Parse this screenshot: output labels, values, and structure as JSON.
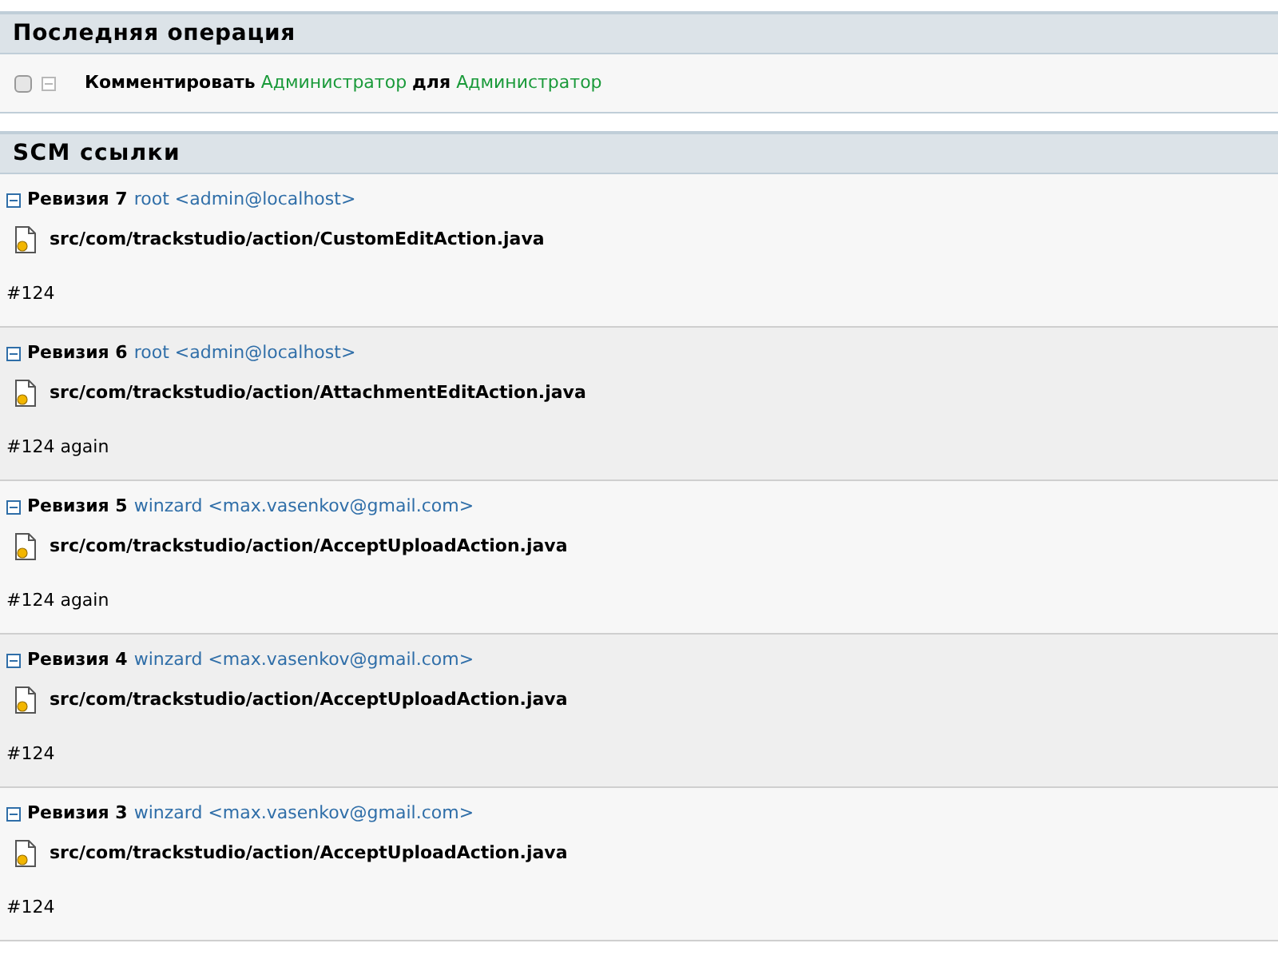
{
  "last_operation": {
    "title": "Последняя операция",
    "checked": false,
    "parts": [
      {
        "kind": "action",
        "text": "Комментировать"
      },
      {
        "kind": "user",
        "text": "Администратор"
      },
      {
        "kind": "action",
        "text": "для"
      },
      {
        "kind": "user",
        "text": "Администратор"
      }
    ]
  },
  "scm": {
    "title": "SCM ссылки",
    "revisions": [
      {
        "label": "Ревизия 7",
        "author": "root <admin@localhost>",
        "expanded": true,
        "file": "src/com/trackstudio/action/CustomEditAction.java",
        "comment": "#124"
      },
      {
        "label": "Ревизия 6",
        "author": "root <admin@localhost>",
        "expanded": true,
        "file": "src/com/trackstudio/action/AttachmentEditAction.java",
        "comment": "#124 again"
      },
      {
        "label": "Ревизия 5",
        "author": "winzard <max.vasenkov@gmail.com>",
        "expanded": true,
        "file": "src/com/trackstudio/action/AcceptUploadAction.java",
        "comment": "#124 again"
      },
      {
        "label": "Ревизия 4",
        "author": "winzard <max.vasenkov@gmail.com>",
        "expanded": true,
        "file": "src/com/trackstudio/action/AcceptUploadAction.java",
        "comment": "#124"
      },
      {
        "label": "Ревизия 3",
        "author": "winzard <max.vasenkov@gmail.com>",
        "expanded": true,
        "file": "src/com/trackstudio/action/AcceptUploadAction.java",
        "comment": "#124"
      }
    ]
  }
}
